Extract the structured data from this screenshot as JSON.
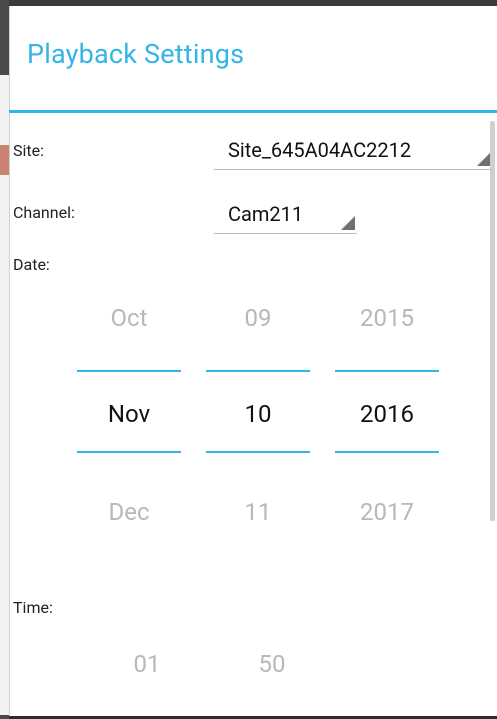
{
  "dialog": {
    "title": "Playback Settings"
  },
  "fields": {
    "site_label": "Site:",
    "site_value": "Site_645A04AC2212",
    "channel_label": "Channel:",
    "channel_value": "Cam211",
    "date_label": "Date:",
    "time_label": "Time:"
  },
  "date_picker": {
    "month": {
      "prev": "Oct",
      "current": "Nov",
      "next": "Dec"
    },
    "day": {
      "prev": "09",
      "current": "10",
      "next": "11"
    },
    "year": {
      "prev": "2015",
      "current": "2016",
      "next": "2017"
    }
  },
  "time_picker": {
    "hour": {
      "prev": "01"
    },
    "minute": {
      "prev": "50"
    }
  },
  "colors": {
    "accent": "#33b5e5",
    "dim_text": "#b8b8b8",
    "text": "#111111"
  }
}
